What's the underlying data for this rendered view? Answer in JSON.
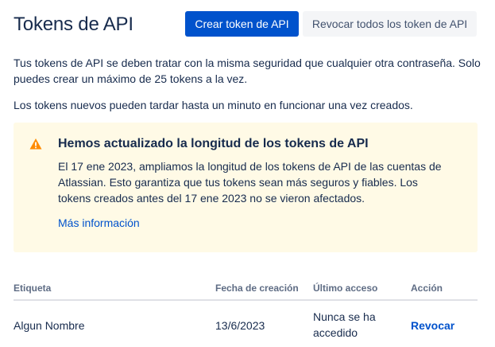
{
  "header": {
    "title": "Tokens de API",
    "create_button": "Crear token de API",
    "revoke_all_button": "Revocar todos los token de API"
  },
  "intro": {
    "paragraph_1": "Tus tokens de API se deben tratar con la misma seguridad que cualquier otra contraseña. Solo puedes crear un máximo de 25 tokens a la vez.",
    "paragraph_2": "Los tokens nuevos pueden tardar hasta un minuto en funcionar una vez creados."
  },
  "notice": {
    "icon": "warning-icon",
    "title": "Hemos actualizado la longitud de los tokens de API",
    "body": "El 17 ene 2023, ampliamos la longitud de los tokens de API de las cuentas de Atlassian. Esto garantiza que tus tokens sean más seguros y fiables. Los tokens creados antes del 17 ene 2023 no se vieron afectados.",
    "link": "Más información",
    "colors": {
      "background": "#fffae6",
      "icon": "#ff8b00"
    }
  },
  "table": {
    "columns": {
      "label": "Etiqueta",
      "created": "Fecha de creación",
      "last_access": "Último acceso",
      "action": "Acción"
    },
    "rows": [
      {
        "label": "Algun Nombre",
        "created": "13/6/2023",
        "last_access": "Nunca se ha accedido",
        "action": "Revocar"
      }
    ]
  },
  "colors": {
    "primary": "#0052cc",
    "text": "#172b4d",
    "muted": "#5e6c84"
  }
}
